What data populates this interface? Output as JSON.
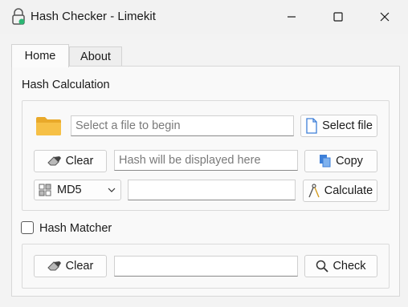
{
  "window": {
    "title": "Hash Checker - Limekit",
    "app_icon": "lock-hash-icon",
    "controls": [
      "minimize-icon",
      "maximize-icon",
      "close-icon"
    ]
  },
  "tabs": [
    {
      "label": "Home",
      "active": true
    },
    {
      "label": "About",
      "active": false
    }
  ],
  "hash_calculation": {
    "section_label": "Hash Calculation",
    "file_input": {
      "value": "",
      "placeholder": "Select a file to begin"
    },
    "select_file_label": "Select file",
    "clear_label": "Clear",
    "hash_output": {
      "value": "",
      "placeholder": "Hash will be displayed here"
    },
    "copy_label": "Copy",
    "algorithm": {
      "selected": "MD5"
    },
    "extra_input": {
      "value": "",
      "placeholder": ""
    },
    "calculate_label": "Calculate"
  },
  "hash_matcher": {
    "label": "Hash Matcher",
    "checked": false,
    "clear_label": "Clear",
    "input": {
      "value": "",
      "placeholder": ""
    },
    "check_label": "Check"
  },
  "colors": {
    "folder": "#f4b93c",
    "copy_icon": "#3d7fd8",
    "accent_green": "#2bb673"
  }
}
